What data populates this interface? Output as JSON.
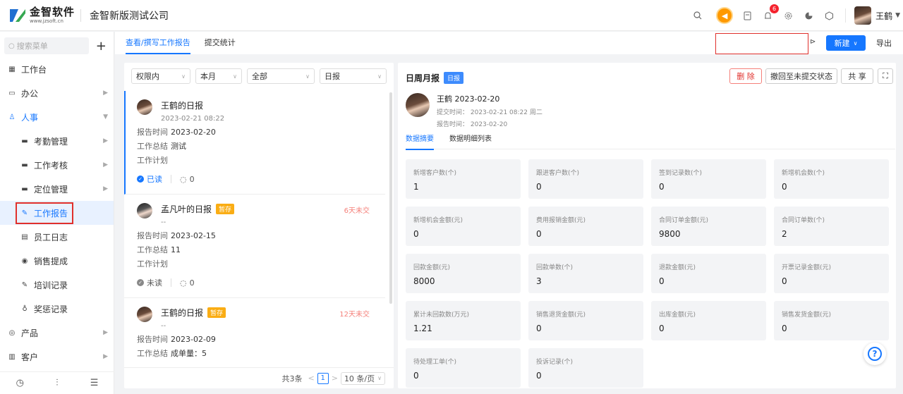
{
  "header": {
    "logo_cn": "金智软件",
    "logo_en": "www.jzsoft.cn",
    "company": "金智新版测试公司",
    "notification_count": "6",
    "user_name": "王鹤"
  },
  "sidebar": {
    "search_placeholder": "搜索菜单",
    "add_label": "+",
    "items": [
      {
        "label": "工作台",
        "icon": "dashboard-icon"
      },
      {
        "label": "办公",
        "icon": "office-icon"
      },
      {
        "label": "人事",
        "icon": "hr-icon"
      },
      {
        "label": "考勤管理",
        "icon": "folder-icon"
      },
      {
        "label": "工作考核",
        "icon": "folder-icon"
      },
      {
        "label": "定位管理",
        "icon": "folder-icon"
      },
      {
        "label": "工作报告",
        "icon": "edit-icon"
      },
      {
        "label": "员工日志",
        "icon": "log-icon"
      },
      {
        "label": "销售提成",
        "icon": "coin-icon"
      },
      {
        "label": "培训记录",
        "icon": "edit-icon"
      },
      {
        "label": "奖惩记录",
        "icon": "medal-icon"
      },
      {
        "label": "产品",
        "icon": "product-icon"
      },
      {
        "label": "客户",
        "icon": "customer-icon"
      }
    ]
  },
  "tabs": [
    {
      "label": "查看/撰写工作报告"
    },
    {
      "label": "提交统计"
    }
  ],
  "toolbar": {
    "new_label": "新建",
    "export_label": "导出"
  },
  "filters": [
    "权限内",
    "本月",
    "全部",
    "日报"
  ],
  "reports": [
    {
      "title": "王鹤的日报",
      "time": "2023-02-21 08:22",
      "draft": "",
      "late": "",
      "report_date": "2023-02-20",
      "summary": "测试",
      "plan": "",
      "read_status": "已读",
      "comments": "0"
    },
    {
      "title": "孟凡叶的日报",
      "time": "--",
      "draft": "暂存",
      "late": "6天未交",
      "report_date": "2023-02-15",
      "summary": "11",
      "plan": "",
      "read_status": "未读",
      "comments": "0"
    },
    {
      "title": "王鹤的日报",
      "time": "--",
      "draft": "暂存",
      "late": "12天未交",
      "report_date": "2023-02-09",
      "summary": "成单量：5",
      "plan": "",
      "read_status": "",
      "comments": ""
    }
  ],
  "labels": {
    "report_time": "报告时间",
    "work_summary": "工作总结",
    "work_plan": "工作计划"
  },
  "pager": {
    "total": "共3条",
    "current": "1",
    "page_size": "10 条/页",
    "prev": "<",
    "next": ">"
  },
  "detail": {
    "title": "日周月报",
    "tag": "日报",
    "delete_label": "删 除",
    "revoke_label": "撤回至未提交状态",
    "share_label": "共 享",
    "author_line": "王鹤 2023-02-20",
    "submit_time": "提交时间：  2023-02-21 08:22 周二",
    "report_time": "报告时间：  2023-02-20",
    "tabs": [
      "数据摘要",
      "数据明细列表"
    ],
    "stats": [
      {
        "label": "新增客户数(个)",
        "value": "1"
      },
      {
        "label": "跟进客户数(个)",
        "value": "0"
      },
      {
        "label": "签到记录数(个)",
        "value": "0"
      },
      {
        "label": "新增机会数(个)",
        "value": "0"
      },
      {
        "label": "新增机会金额(元)",
        "value": "0"
      },
      {
        "label": "费用报销金额(元)",
        "value": "0"
      },
      {
        "label": "合同订单金额(元)",
        "value": "9800"
      },
      {
        "label": "合同订单数(个)",
        "value": "2"
      },
      {
        "label": "回款金额(元)",
        "value": "8000"
      },
      {
        "label": "回款单数(个)",
        "value": "3"
      },
      {
        "label": "退款金额(元)",
        "value": "0"
      },
      {
        "label": "开票记录金额(元)",
        "value": "0"
      },
      {
        "label": "累计未回款数(万元)",
        "value": "1.21"
      },
      {
        "label": "销售退货金额(元)",
        "value": "0"
      },
      {
        "label": "出库金额(元)",
        "value": "0"
      },
      {
        "label": "销售发货金额(元)",
        "value": "0"
      },
      {
        "label": "待处理工单(个)",
        "value": "0"
      },
      {
        "label": "投诉记录(个)",
        "value": "0"
      }
    ]
  }
}
